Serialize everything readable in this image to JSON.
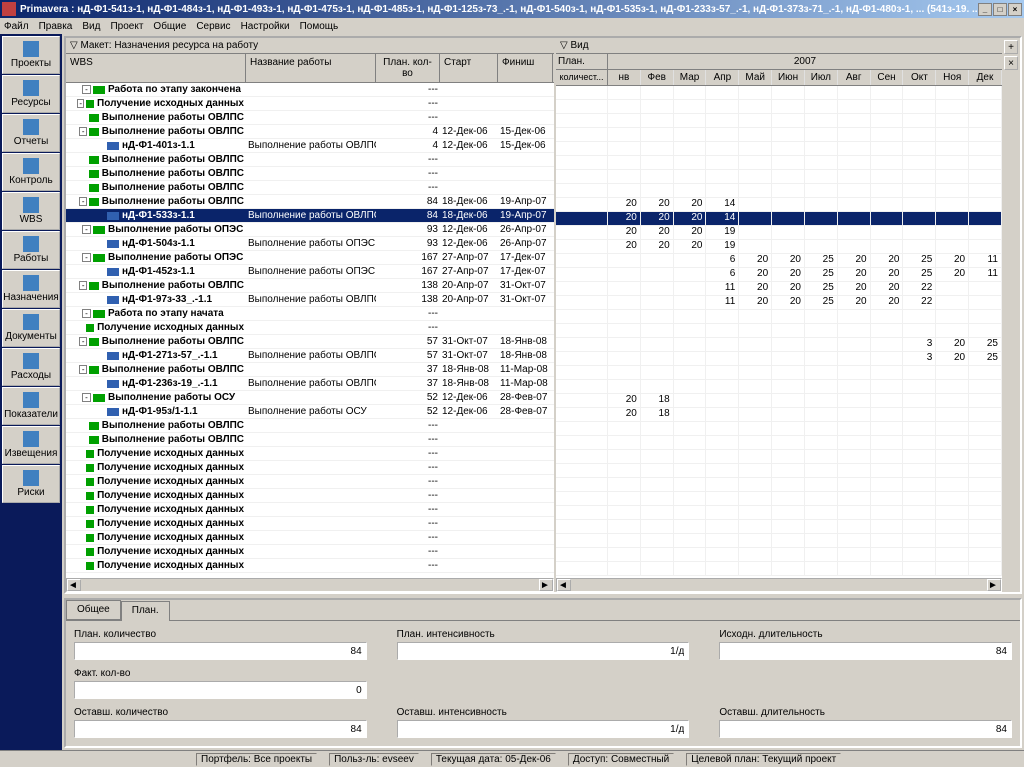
{
  "title": "Primavera : нД-Ф1-541з-1, нД-Ф1-484з-1, нД-Ф1-493з-1, нД-Ф1-475з-1, нД-Ф1-485з-1, нД-Ф1-125з-73_.-1, нД-Ф1-540з-1, нД-Ф1-535з-1, нД-Ф1-233з-57_.-1, нД-Ф1-373з-71_.-1, нД-Ф1-480з-1, ... (541з-19. ...",
  "menu": [
    "Файл",
    "Правка",
    "Вид",
    "Проект",
    "Общие",
    "Сервис",
    "Настройки",
    "Помощь"
  ],
  "sidebar": [
    "Проекты",
    "Ресурсы",
    "Отчеты",
    "Контроль",
    "WBS",
    "Работы",
    "Назначения",
    "Документы",
    "Расходы",
    "Показатели",
    "Извещения",
    "Риски"
  ],
  "leftHeader": "Макет: Назначения ресурса на работу",
  "rightHeader": "Вид",
  "cols": {
    "wbs": "WBS",
    "name": "Название работы",
    "qty": "План. кол-во",
    "start": "Старт",
    "finish": "Финиш"
  },
  "ganttCols": {
    "plan": "План.",
    "plan2": "количест...",
    "year": "2007"
  },
  "months": [
    "нв",
    "Фев",
    "Мар",
    "Апр",
    "Май",
    "Июн",
    "Июл",
    "Авг",
    "Сен",
    "Окт",
    "Ноя",
    "Дек"
  ],
  "tabs": [
    "Общее",
    "План."
  ],
  "fields": {
    "f1l": "План. количество",
    "f1v": "84",
    "f2l": "План. интенсивность",
    "f2v": "1/д",
    "f3l": "Исходн. длительность",
    "f3v": "84",
    "f4l": "Факт. кол-во",
    "f4v": "0",
    "f5l": "Оставш. количество",
    "f5v": "84",
    "f6l": "Оставш. интенсивность",
    "f6v": "1/д",
    "f7l": "Оставш. длительность",
    "f7v": "84"
  },
  "status": {
    "s1": "Портфель: Все проекты",
    "s2": "Польз-ль: evseev",
    "s3": "Текущая дата: 05-Дек-06",
    "s4": "Доступ: Совместный",
    "s5": "Целевой план: Текущий проект"
  },
  "rows": [
    {
      "ind": 1,
      "exp": "-",
      "ico": "grn",
      "wbs": "Работа по этапу закончена",
      "name": "",
      "qty": "---",
      "start": "",
      "fin": "",
      "g": []
    },
    {
      "ind": 1,
      "exp": "-",
      "ico": "grn",
      "wbs": "Получение исходных данных",
      "name": "",
      "qty": "---",
      "start": "",
      "fin": "",
      "g": []
    },
    {
      "ind": 1,
      "exp": "",
      "ico": "grn",
      "wbs": "Выполнение работы ОВЛПС",
      "name": "",
      "qty": "---",
      "start": "",
      "fin": "",
      "g": []
    },
    {
      "ind": 1,
      "exp": "-",
      "ico": "grn",
      "wbs": "Выполнение работы ОВЛПС",
      "name": "",
      "qty": "4",
      "start": "12-Дек-06",
      "fin": "15-Дек-06",
      "g": []
    },
    {
      "ind": 2,
      "exp": "",
      "ico": "blu",
      "wbs": "нД-Ф1-401з-1.1",
      "name": "Выполнение работы ОВЛПС",
      "qty": "4",
      "start": "12-Дек-06",
      "fin": "15-Дек-06",
      "g": []
    },
    {
      "ind": 1,
      "exp": "",
      "ico": "grn",
      "wbs": "Выполнение работы ОВЛПС",
      "name": "",
      "qty": "---",
      "start": "",
      "fin": "",
      "g": []
    },
    {
      "ind": 1,
      "exp": "",
      "ico": "grn",
      "wbs": "Выполнение работы ОВЛПС",
      "name": "",
      "qty": "---",
      "start": "",
      "fin": "",
      "g": []
    },
    {
      "ind": 1,
      "exp": "",
      "ico": "grn",
      "wbs": "Выполнение работы ОВЛПС",
      "name": "",
      "qty": "---",
      "start": "",
      "fin": "",
      "g": []
    },
    {
      "ind": 1,
      "exp": "-",
      "ico": "grn",
      "wbs": "Выполнение работы ОВЛПС",
      "name": "",
      "qty": "84",
      "start": "18-Дек-06",
      "fin": "19-Апр-07",
      "g": [
        "",
        "20",
        "20",
        "20",
        "14",
        "",
        "",
        "",
        "",
        "",
        "",
        ""
      ]
    },
    {
      "sel": true,
      "ind": 2,
      "exp": "",
      "ico": "blu",
      "wbs": "нД-Ф1-533з-1.1",
      "name": "Выполнение работы ОВЛПС",
      "qty": "84",
      "start": "18-Дек-06",
      "fin": "19-Апр-07",
      "g": [
        "",
        "20",
        "20",
        "20",
        "14",
        "",
        "",
        "",
        "",
        "",
        "",
        ""
      ]
    },
    {
      "ind": 1,
      "exp": "-",
      "ico": "grn",
      "wbs": "Выполнение работы ОПЭС",
      "name": "",
      "qty": "93",
      "start": "12-Дек-06",
      "fin": "26-Апр-07",
      "g": [
        "",
        "20",
        "20",
        "20",
        "19",
        "",
        "",
        "",
        "",
        "",
        "",
        ""
      ]
    },
    {
      "ind": 2,
      "exp": "",
      "ico": "blu",
      "wbs": "нД-Ф1-504з-1.1",
      "name": "Выполнение работы ОПЭС",
      "qty": "93",
      "start": "12-Дек-06",
      "fin": "26-Апр-07",
      "g": [
        "",
        "20",
        "20",
        "20",
        "19",
        "",
        "",
        "",
        "",
        "",
        "",
        ""
      ]
    },
    {
      "ind": 1,
      "exp": "-",
      "ico": "grn",
      "wbs": "Выполнение работы ОПЭС",
      "name": "",
      "qty": "167",
      "start": "27-Апр-07",
      "fin": "17-Дек-07",
      "g": [
        "",
        "",
        "",
        "",
        "6",
        "20",
        "20",
        "25",
        "20",
        "20",
        "25",
        "20",
        "11"
      ]
    },
    {
      "ind": 2,
      "exp": "",
      "ico": "blu",
      "wbs": "нД-Ф1-452з-1.1",
      "name": "Выполнение работы ОПЭС",
      "qty": "167",
      "start": "27-Апр-07",
      "fin": "17-Дек-07",
      "g": [
        "",
        "",
        "",
        "",
        "6",
        "20",
        "20",
        "25",
        "20",
        "20",
        "25",
        "20",
        "11"
      ]
    },
    {
      "ind": 1,
      "exp": "-",
      "ico": "grn",
      "wbs": "Выполнение работы ОВЛПС",
      "name": "",
      "qty": "138",
      "start": "20-Апр-07",
      "fin": "31-Окт-07",
      "g": [
        "",
        "",
        "",
        "",
        "11",
        "20",
        "20",
        "25",
        "20",
        "20",
        "22",
        "",
        ""
      ]
    },
    {
      "ind": 2,
      "exp": "",
      "ico": "blu",
      "wbs": "нД-Ф1-97з-33_.-1.1",
      "name": "Выполнение работы ОВЛПС",
      "qty": "138",
      "start": "20-Апр-07",
      "fin": "31-Окт-07",
      "g": [
        "",
        "",
        "",
        "",
        "11",
        "20",
        "20",
        "25",
        "20",
        "20",
        "22",
        "",
        ""
      ]
    },
    {
      "ind": 1,
      "exp": "-",
      "ico": "grn",
      "wbs": "Работа по этапу начата",
      "name": "",
      "qty": "---",
      "start": "",
      "fin": "",
      "g": []
    },
    {
      "ind": 1,
      "exp": "",
      "ico": "grn",
      "wbs": "Получение исходных данных",
      "name": "",
      "qty": "---",
      "start": "",
      "fin": "",
      "g": []
    },
    {
      "ind": 1,
      "exp": "-",
      "ico": "grn",
      "wbs": "Выполнение работы ОВЛПС",
      "name": "",
      "qty": "57",
      "start": "31-Окт-07",
      "fin": "18-Янв-08",
      "g": [
        "",
        "",
        "",
        "",
        "",
        "",
        "",
        "",
        "",
        "",
        "3",
        "20",
        "25"
      ]
    },
    {
      "ind": 2,
      "exp": "",
      "ico": "blu",
      "wbs": "нД-Ф1-271з-57_.-1.1",
      "name": "Выполнение работы ОВЛПС",
      "qty": "57",
      "start": "31-Окт-07",
      "fin": "18-Янв-08",
      "g": [
        "",
        "",
        "",
        "",
        "",
        "",
        "",
        "",
        "",
        "",
        "3",
        "20",
        "25"
      ]
    },
    {
      "ind": 1,
      "exp": "-",
      "ico": "grn",
      "wbs": "Выполнение работы ОВЛПС",
      "name": "",
      "qty": "37",
      "start": "18-Янв-08",
      "fin": "11-Мар-08",
      "g": []
    },
    {
      "ind": 2,
      "exp": "",
      "ico": "blu",
      "wbs": "нД-Ф1-236з-19_.-1.1",
      "name": "Выполнение работы ОВЛПС",
      "qty": "37",
      "start": "18-Янв-08",
      "fin": "11-Мар-08",
      "g": []
    },
    {
      "ind": 1,
      "exp": "-",
      "ico": "grn",
      "wbs": "Выполнение работы ОСУ",
      "name": "",
      "qty": "52",
      "start": "12-Дек-06",
      "fin": "28-Фев-07",
      "g": [
        "",
        "20",
        "18",
        "",
        "",
        "",
        "",
        "",
        "",
        "",
        "",
        "",
        ""
      ]
    },
    {
      "ind": 2,
      "exp": "",
      "ico": "blu",
      "wbs": "нД-Ф1-95з/1-1.1",
      "name": "Выполнение работы ОСУ",
      "qty": "52",
      "start": "12-Дек-06",
      "fin": "28-Фев-07",
      "g": [
        "",
        "20",
        "18",
        "",
        "",
        "",
        "",
        "",
        "",
        "",
        "",
        "",
        ""
      ]
    },
    {
      "ind": 1,
      "exp": "",
      "ico": "grn",
      "wbs": "Выполнение работы ОВЛПС",
      "name": "",
      "qty": "---",
      "start": "",
      "fin": "",
      "g": []
    },
    {
      "ind": 1,
      "exp": "",
      "ico": "grn",
      "wbs": "Выполнение работы ОВЛПС",
      "name": "",
      "qty": "---",
      "start": "",
      "fin": "",
      "g": []
    },
    {
      "ind": 1,
      "exp": "",
      "ico": "grn",
      "wbs": "Получение исходных данных",
      "name": "",
      "qty": "---",
      "start": "",
      "fin": "",
      "g": []
    },
    {
      "ind": 1,
      "exp": "",
      "ico": "grn",
      "wbs": "Получение исходных данных",
      "name": "",
      "qty": "---",
      "start": "",
      "fin": "",
      "g": []
    },
    {
      "ind": 1,
      "exp": "",
      "ico": "grn",
      "wbs": "Получение исходных данных",
      "name": "",
      "qty": "---",
      "start": "",
      "fin": "",
      "g": []
    },
    {
      "ind": 1,
      "exp": "",
      "ico": "grn",
      "wbs": "Получение исходных данных",
      "name": "",
      "qty": "---",
      "start": "",
      "fin": "",
      "g": []
    },
    {
      "ind": 1,
      "exp": "",
      "ico": "grn",
      "wbs": "Получение исходных данных",
      "name": "",
      "qty": "---",
      "start": "",
      "fin": "",
      "g": []
    },
    {
      "ind": 1,
      "exp": "",
      "ico": "grn",
      "wbs": "Получение исходных данных",
      "name": "",
      "qty": "---",
      "start": "",
      "fin": "",
      "g": []
    },
    {
      "ind": 1,
      "exp": "",
      "ico": "grn",
      "wbs": "Получение исходных данных",
      "name": "",
      "qty": "---",
      "start": "",
      "fin": "",
      "g": []
    },
    {
      "ind": 1,
      "exp": "",
      "ico": "grn",
      "wbs": "Получение исходных данных",
      "name": "",
      "qty": "---",
      "start": "",
      "fin": "",
      "g": []
    },
    {
      "ind": 1,
      "exp": "",
      "ico": "grn",
      "wbs": "Получение исходных данных",
      "name": "",
      "qty": "---",
      "start": "",
      "fin": "",
      "g": []
    }
  ]
}
